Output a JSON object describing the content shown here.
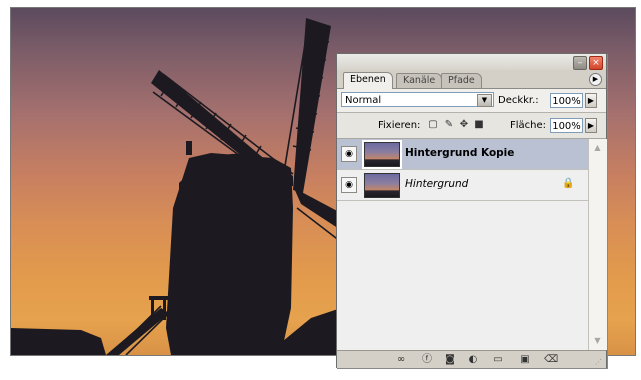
{
  "panel": {
    "tabs": [
      {
        "label": "Ebenen",
        "active": true
      },
      {
        "label": "Kanäle",
        "active": false
      },
      {
        "label": "Pfade",
        "active": false
      }
    ],
    "blend_mode": "Normal",
    "opacity_label": "Deckkr.:",
    "opacity_value": "100%",
    "lock_label": "Fixieren:",
    "fill_label": "Fläche:",
    "fill_value": "100%",
    "layers": [
      {
        "name": "Hintergrund Kopie",
        "selected": true,
        "visible": true,
        "locked": false
      },
      {
        "name": "Hintergrund",
        "selected": false,
        "visible": true,
        "locked": true
      }
    ],
    "footer_icons": [
      "link-icon",
      "layer-style-icon",
      "mask-icon",
      "adjustment-icon",
      "group-folder-icon",
      "new-layer-icon",
      "trash-icon"
    ]
  },
  "colors": {
    "sky_top": "#5b4a5e",
    "sky_bottom": "#e29b4c",
    "panel_bg": "#d4d0c8",
    "selected_layer": "#b9c1d3"
  }
}
